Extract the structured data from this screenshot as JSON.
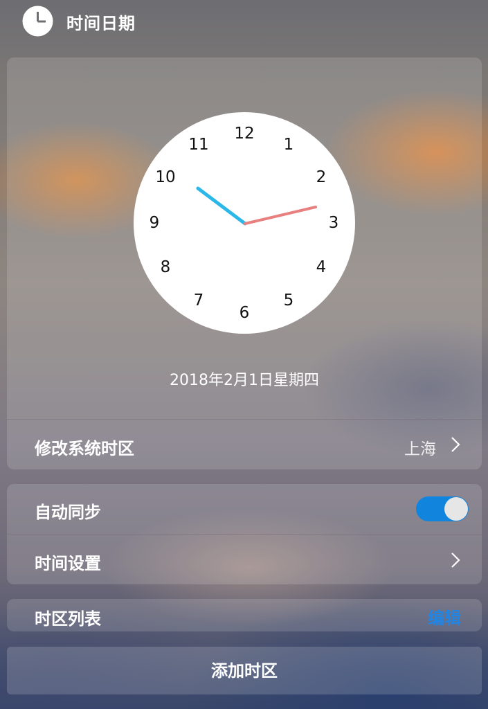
{
  "header": {
    "title": "时间日期",
    "icon": "clock-icon"
  },
  "clock": {
    "numbers": [
      "12",
      "1",
      "2",
      "3",
      "4",
      "5",
      "6",
      "7",
      "8",
      "9",
      "10",
      "11"
    ],
    "hour_hand_color": "#2bb8e8",
    "minute_hand_color": "#e88080",
    "face_color": "#ffffff"
  },
  "date_text": "2018年2月1日星期四",
  "timezone": {
    "label": "修改系统时区",
    "value": "上海"
  },
  "auto_sync": {
    "label": "自动同步",
    "enabled": true,
    "toggle_color": "#1185dd"
  },
  "time_settings": {
    "label": "时间设置"
  },
  "timezone_list": {
    "label": "时区列表",
    "edit": "编辑",
    "edit_color": "#1f86e6"
  },
  "add_timezone": {
    "label": "添加时区"
  }
}
